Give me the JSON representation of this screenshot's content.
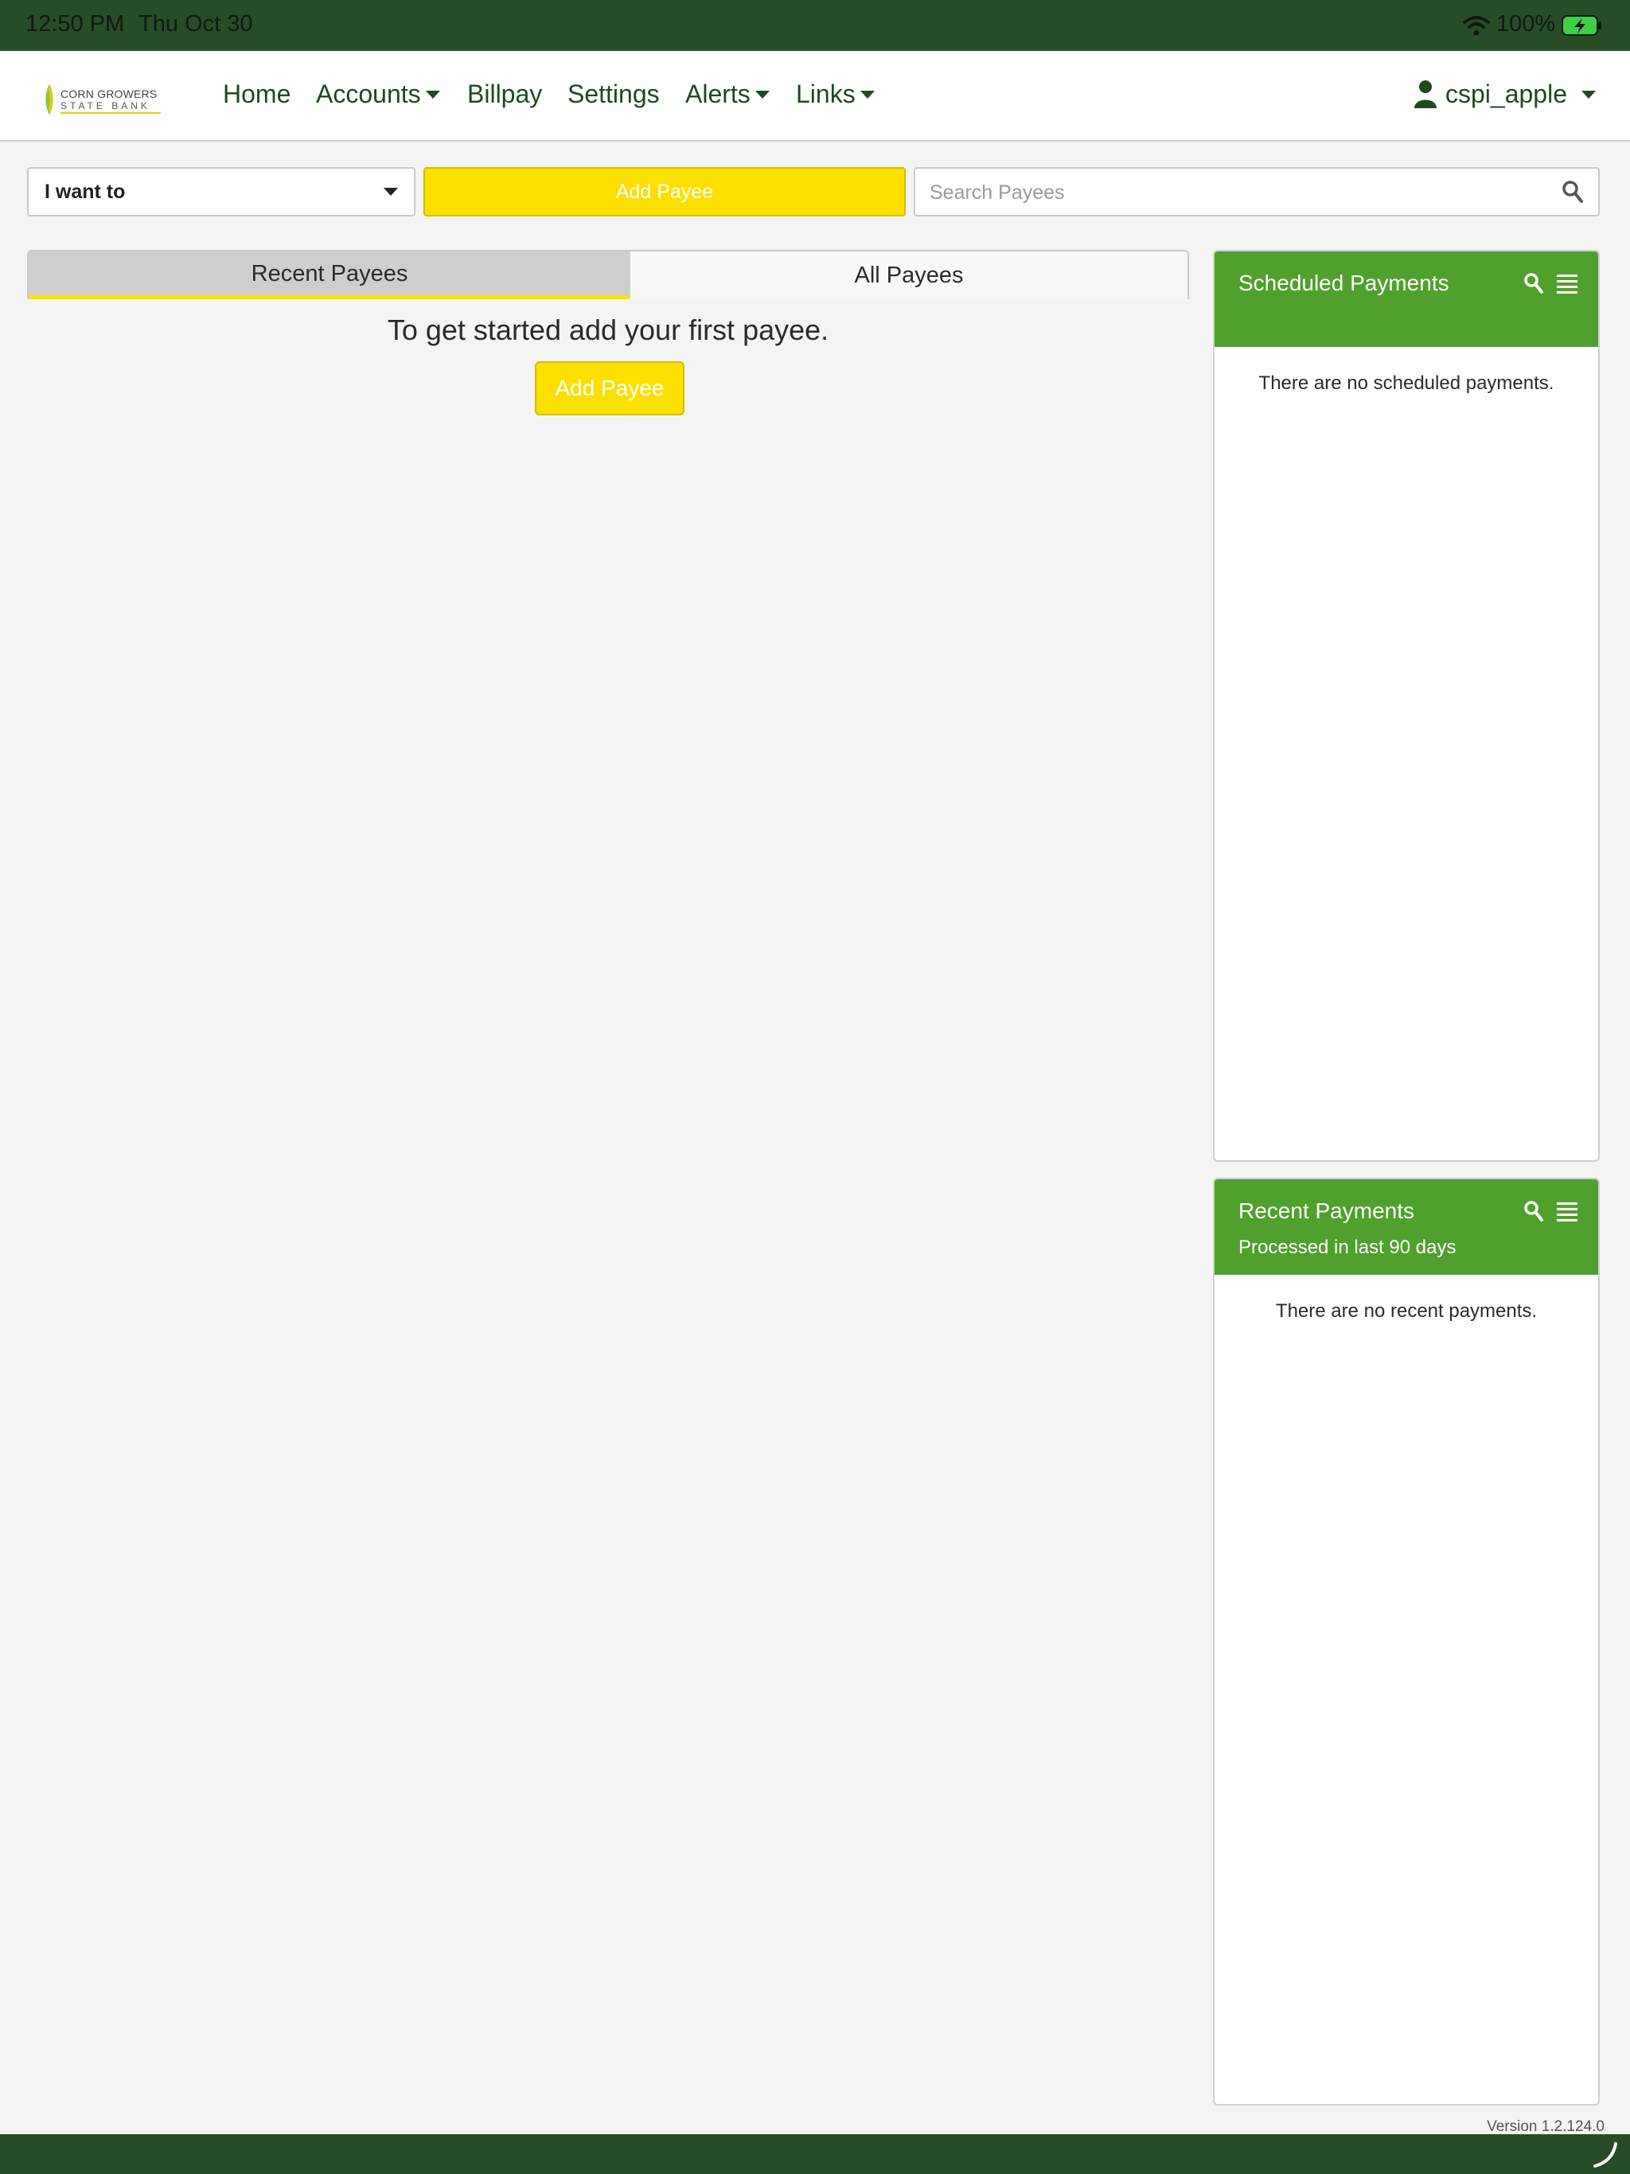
{
  "status_bar": {
    "time": "12:50 PM",
    "date": "Thu Oct 30",
    "battery_percent": "100%",
    "icons": [
      "wifi-icon",
      "battery-charging-icon"
    ]
  },
  "navbar": {
    "logo": {
      "line1": "CORN GROWERS",
      "line2": "STATE BANK"
    },
    "items": [
      {
        "label": "Home",
        "has_dropdown": false
      },
      {
        "label": "Accounts",
        "has_dropdown": true
      },
      {
        "label": "Billpay",
        "has_dropdown": false
      },
      {
        "label": "Settings",
        "has_dropdown": false
      },
      {
        "label": "Alerts",
        "has_dropdown": true
      },
      {
        "label": "Links",
        "has_dropdown": true
      }
    ],
    "user": {
      "name": "cspi_apple",
      "icon": "user-icon"
    }
  },
  "toolbar": {
    "action_select": "I want to",
    "add_payee_label": "Add Payee",
    "search": {
      "placeholder": "Search Payees",
      "value": ""
    }
  },
  "payees": {
    "tabs": [
      {
        "label": "Recent Payees",
        "active": true
      },
      {
        "label": "All Payees",
        "active": false
      }
    ],
    "empty_message": "To get started add your first payee.",
    "add_payee_label": "Add Payee"
  },
  "scheduled_payments": {
    "title": "Scheduled Payments",
    "empty_message": "There are no scheduled payments."
  },
  "recent_payments": {
    "title": "Recent Payments",
    "subtitle": "Processed in last 90 days",
    "empty_message": "There are no recent payments."
  },
  "footer": {
    "version": "Version 1.2.124.0"
  },
  "colors": {
    "brand_dark_green": "#264d26",
    "nav_text_green": "#1e4a1e",
    "panel_header_green": "#50a02d",
    "accent_yellow": "#fbe000",
    "page_background": "#f4f4f4"
  }
}
